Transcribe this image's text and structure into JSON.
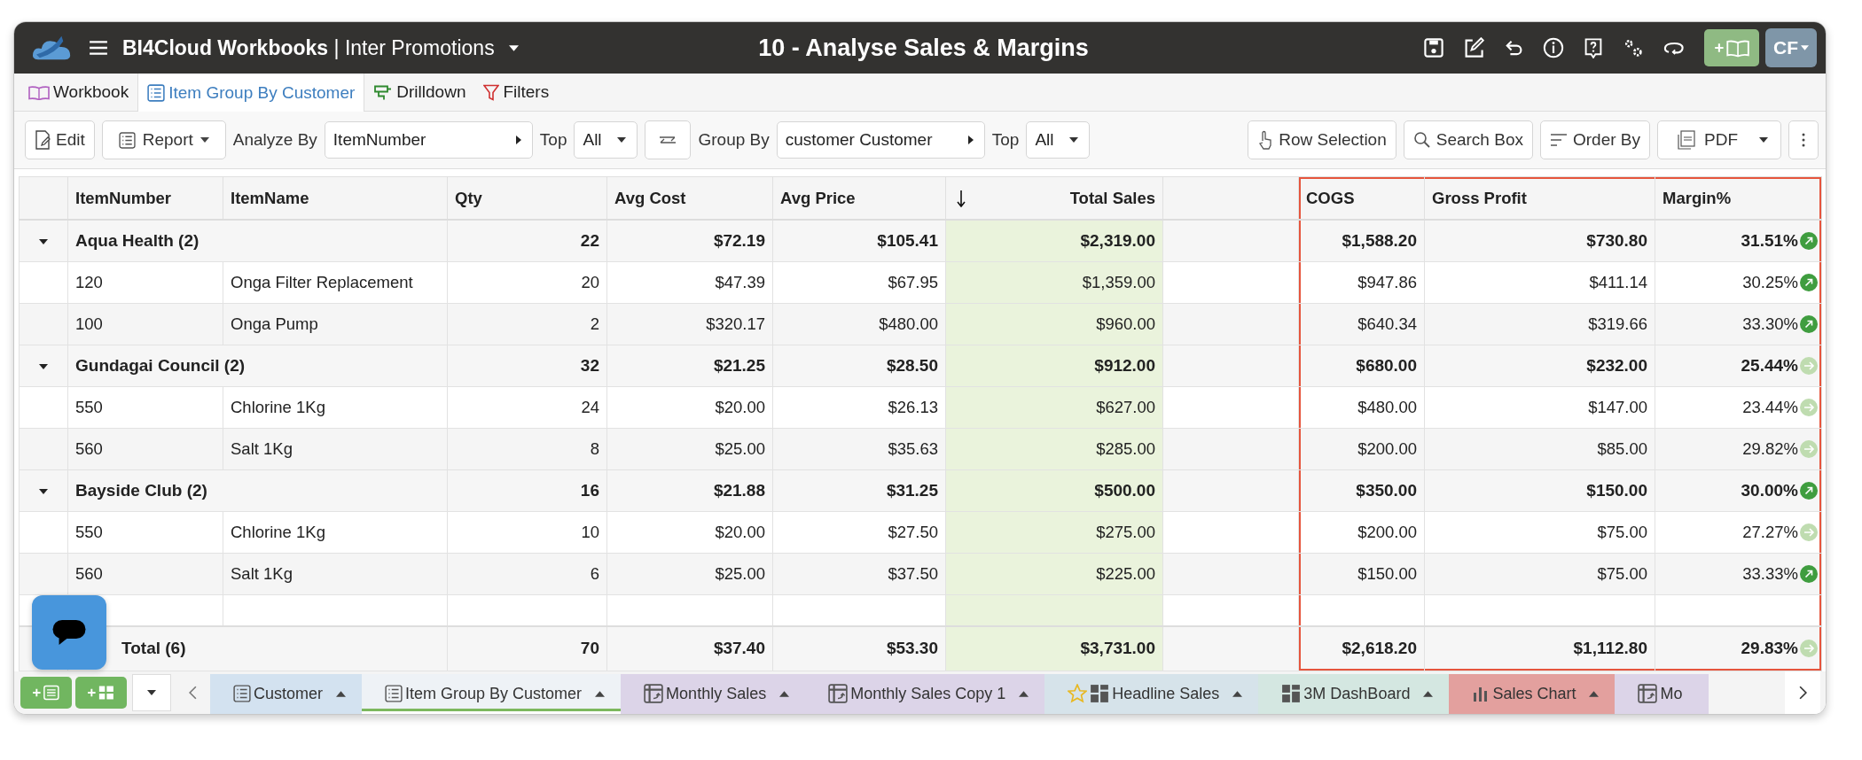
{
  "header": {
    "workspace": "**BI4Cloud Workbooks** | Inter Promotions",
    "title": "10 - Analyse Sales & Margins",
    "user_initials": "CF"
  },
  "tabs": [
    {
      "label": "Workbook",
      "kind": "workbook",
      "selected": false
    },
    {
      "label": "Item Group By Customer",
      "kind": "report",
      "selected": true
    },
    {
      "label": "Drilldown",
      "kind": "drilldown",
      "selected": false
    },
    {
      "label": "Filters",
      "kind": "filter",
      "selected": false
    }
  ],
  "toolbar": {
    "edit": "Edit",
    "report": "Report",
    "analyze_label": "Analyze By",
    "analyze_value": "ItemNumber",
    "top_label": "Top",
    "top_value": "All",
    "group_label": "Group By",
    "group_value": "customer Customer",
    "group_top_label": "Top",
    "group_top_value": "All",
    "row_selection": "Row Selection",
    "search_box": "Search Box",
    "order_by": "Order By",
    "pdf": "PDF"
  },
  "table": {
    "columns": [
      {
        "label": "ItemNumber",
        "kind": "text",
        "sorted": false,
        "outlined": false
      },
      {
        "label": "ItemName",
        "kind": "text",
        "sorted": false,
        "outlined": false
      },
      {
        "label": "Qty",
        "kind": "number",
        "sorted": false,
        "outlined": false
      },
      {
        "label": "Avg Cost",
        "kind": "number",
        "sorted": false,
        "outlined": false
      },
      {
        "label": "Avg Price",
        "kind": "number",
        "sorted": false,
        "outlined": false
      },
      {
        "label": "Total Sales",
        "kind": "number",
        "sorted": true,
        "outlined": false
      },
      {
        "kind": "spacer"
      },
      {
        "label": "COGS",
        "kind": "number",
        "sorted": false,
        "outlined": true
      },
      {
        "label": "Gross Profit",
        "kind": "number",
        "sorted": false,
        "outlined": true
      },
      {
        "label": "Margin%",
        "kind": "number",
        "sorted": false,
        "outlined": true
      }
    ],
    "rows": [
      {
        "kind": "group",
        "label": "Aqua Health (2)",
        "expanded": true,
        "cells": [
          "22",
          "$72.19",
          "$105.41",
          "$2,319.00",
          "$1,588.20",
          "$730.80",
          "31.51%"
        ],
        "trending_up": true
      },
      {
        "kind": "item",
        "cells": [
          "120",
          "Onga Filter Replacement",
          "20",
          "$47.39",
          "$67.95",
          "$1,359.00",
          "$947.86",
          "$411.14",
          "30.25%"
        ],
        "trending_up": true
      },
      {
        "kind": "item",
        "cells": [
          "100",
          "Onga Pump",
          "2",
          "$320.17",
          "$480.00",
          "$960.00",
          "$640.34",
          "$319.66",
          "33.30%"
        ],
        "trending_up": true
      },
      {
        "kind": "group",
        "label": "Gundagai Council (2)",
        "expanded": true,
        "cells": [
          "32",
          "$21.25",
          "$28.50",
          "$912.00",
          "$680.00",
          "$232.00",
          "25.44%"
        ],
        "trending_up": false
      },
      {
        "kind": "item",
        "cells": [
          "550",
          "Chlorine 1Kg",
          "24",
          "$20.00",
          "$26.13",
          "$627.00",
          "$480.00",
          "$147.00",
          "23.44%"
        ],
        "trending_up": false
      },
      {
        "kind": "item",
        "cells": [
          "560",
          "Salt 1Kg",
          "8",
          "$25.00",
          "$35.63",
          "$285.00",
          "$200.00",
          "$85.00",
          "29.82%"
        ],
        "trending_up": false
      },
      {
        "kind": "group",
        "label": "Bayside Club (2)",
        "expanded": true,
        "cells": [
          "16",
          "$21.88",
          "$31.25",
          "$500.00",
          "$350.00",
          "$150.00",
          "30.00%"
        ],
        "trending_up": true
      },
      {
        "kind": "item",
        "cells": [
          "550",
          "Chlorine 1Kg",
          "10",
          "$20.00",
          "$27.50",
          "$275.00",
          "$200.00",
          "$75.00",
          "27.27%"
        ],
        "trending_up": false
      },
      {
        "kind": "item",
        "cells": [
          "560",
          "Salt 1Kg",
          "6",
          "$25.00",
          "$37.50",
          "$225.00",
          "$150.00",
          "$75.00",
          "33.33%"
        ],
        "trending_up": true
      },
      {
        "kind": "blank"
      },
      {
        "kind": "total",
        "label": "Total (6)",
        "cells": [
          "70",
          "$37.40",
          "$53.30",
          "$3,731.00",
          "$2,618.20",
          "$1,112.80",
          "29.83%"
        ],
        "trending_up": false
      }
    ]
  },
  "sheet_tabs": [
    {
      "label": "Customer",
      "kind": "report",
      "color": "#d3e2f0",
      "selected": false,
      "starred": false
    },
    {
      "label": "Item Group By Customer",
      "kind": "report",
      "color": "#eef2f6",
      "selected": true,
      "starred": false
    },
    {
      "label": "Monthly Sales",
      "kind": "pivot",
      "color": "#dcd4e8",
      "selected": false,
      "starred": false
    },
    {
      "label": "Monthly Sales Copy 1",
      "kind": "pivot",
      "color": "#dcd4e8",
      "selected": false,
      "starred": false
    },
    {
      "label": "Headline Sales",
      "kind": "dashboard",
      "color": "#d6e3ea",
      "selected": false,
      "starred": true
    },
    {
      "label": "3M DashBoard",
      "kind": "dashboard",
      "color": "#d4e7e1",
      "selected": false,
      "starred": false
    },
    {
      "label": "Sales Chart",
      "kind": "chart",
      "color": "#e3a09e",
      "selected": false,
      "starred": false
    },
    {
      "label": "Mo",
      "kind": "pivot",
      "color": "#dcd4e8",
      "selected": false,
      "starred": false
    }
  ]
}
